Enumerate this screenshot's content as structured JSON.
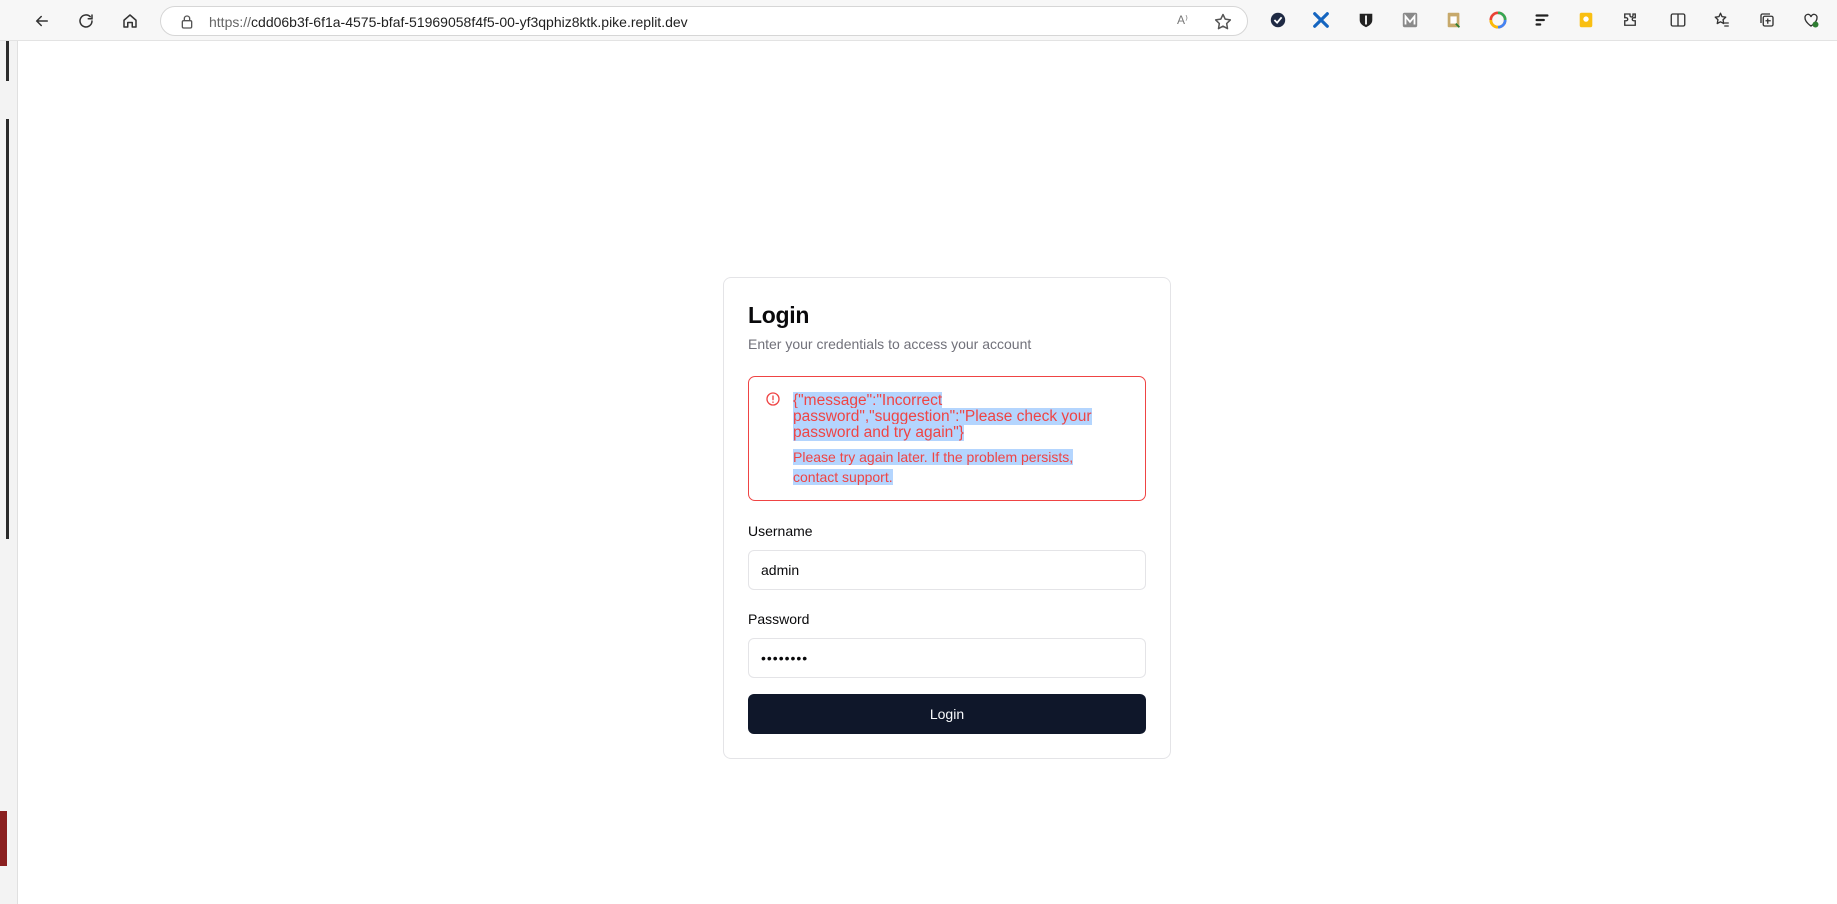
{
  "browser": {
    "url_protocol": "https://",
    "url_host": "cdd06b3f-6f1a-4575-bfaf-51969058f4f5-00-yf3qphiz8ktk.pike.replit.dev",
    "read_aloud_label": "A⁾"
  },
  "login": {
    "title": "Login",
    "subtitle": "Enter your credentials to access your account",
    "error": {
      "title": "{\"message\":\"Incorrect password\",\"suggestion\":\"Please check your password and try again\"}",
      "description": "Please try again later. If the problem persists, contact support.",
      "color": "#ef4444"
    },
    "username_label": "Username",
    "username_value": "admin",
    "password_label": "Password",
    "password_value": "••••••••",
    "submit_label": "Login",
    "button_color": "#0f172a"
  }
}
